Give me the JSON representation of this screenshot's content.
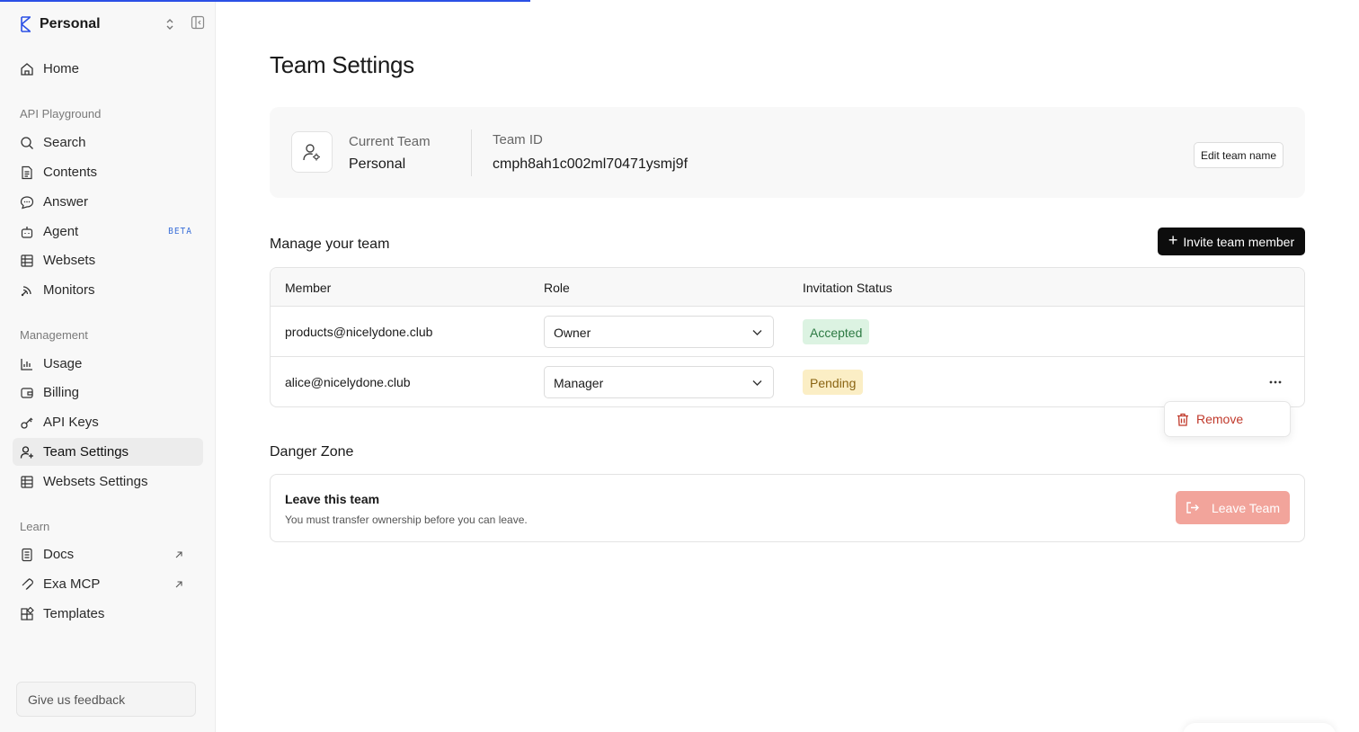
{
  "app": {
    "team_name": "Personal"
  },
  "sidebar": {
    "home": "Home",
    "sections": [
      {
        "label": "API Playground"
      },
      {
        "label": "Management"
      },
      {
        "label": "Learn"
      }
    ],
    "api_playground": [
      {
        "label": "Search",
        "icon": "search-icon"
      },
      {
        "label": "Contents",
        "icon": "document-icon"
      },
      {
        "label": "Answer",
        "icon": "chat-bubble-icon"
      },
      {
        "label": "Agent",
        "icon": "robot-icon",
        "badge": "BETA"
      },
      {
        "label": "Websets",
        "icon": "grid-icon"
      },
      {
        "label": "Monitors",
        "icon": "signal-icon"
      }
    ],
    "management": [
      {
        "label": "Usage",
        "icon": "bar-chart-icon"
      },
      {
        "label": "Billing",
        "icon": "wallet-icon"
      },
      {
        "label": "API Keys",
        "icon": "key-icon"
      },
      {
        "label": "Team Settings",
        "icon": "user-plus-icon",
        "active": true
      },
      {
        "label": "Websets Settings",
        "icon": "grid-icon"
      }
    ],
    "learn": [
      {
        "label": "Docs",
        "icon": "doc-icon",
        "external": true
      },
      {
        "label": "Exa MCP",
        "icon": "mcp-icon",
        "external": true
      },
      {
        "label": "Templates",
        "icon": "templates-icon"
      }
    ],
    "feedback": "Give us feedback"
  },
  "page": {
    "title": "Team Settings",
    "current_team_label": "Current Team",
    "current_team_value": "Personal",
    "team_id_label": "Team ID",
    "team_id_value": "cmph8ah1c002ml70471ysmj9f",
    "edit_team_name": "Edit team name"
  },
  "manage": {
    "title": "Manage your team",
    "invite_label": "Invite team member",
    "columns": [
      "Member",
      "Role",
      "Invitation Status"
    ],
    "rows": [
      {
        "email": "products@nicelydone.club",
        "role": "Owner",
        "status": "Accepted"
      },
      {
        "email": "alice@nicelydone.club",
        "role": "Manager",
        "status": "Pending"
      }
    ],
    "menu_remove": "Remove"
  },
  "danger": {
    "title": "Danger Zone",
    "card_title": "Leave this team",
    "card_desc": "You must transfer ownership before you can leave.",
    "leave_label": "Leave Team"
  },
  "colors": {
    "accent": "#2b50e6",
    "accepted_bg": "#dcf3e2",
    "pending_bg": "#fbeec5",
    "danger": "#f2a49b"
  }
}
